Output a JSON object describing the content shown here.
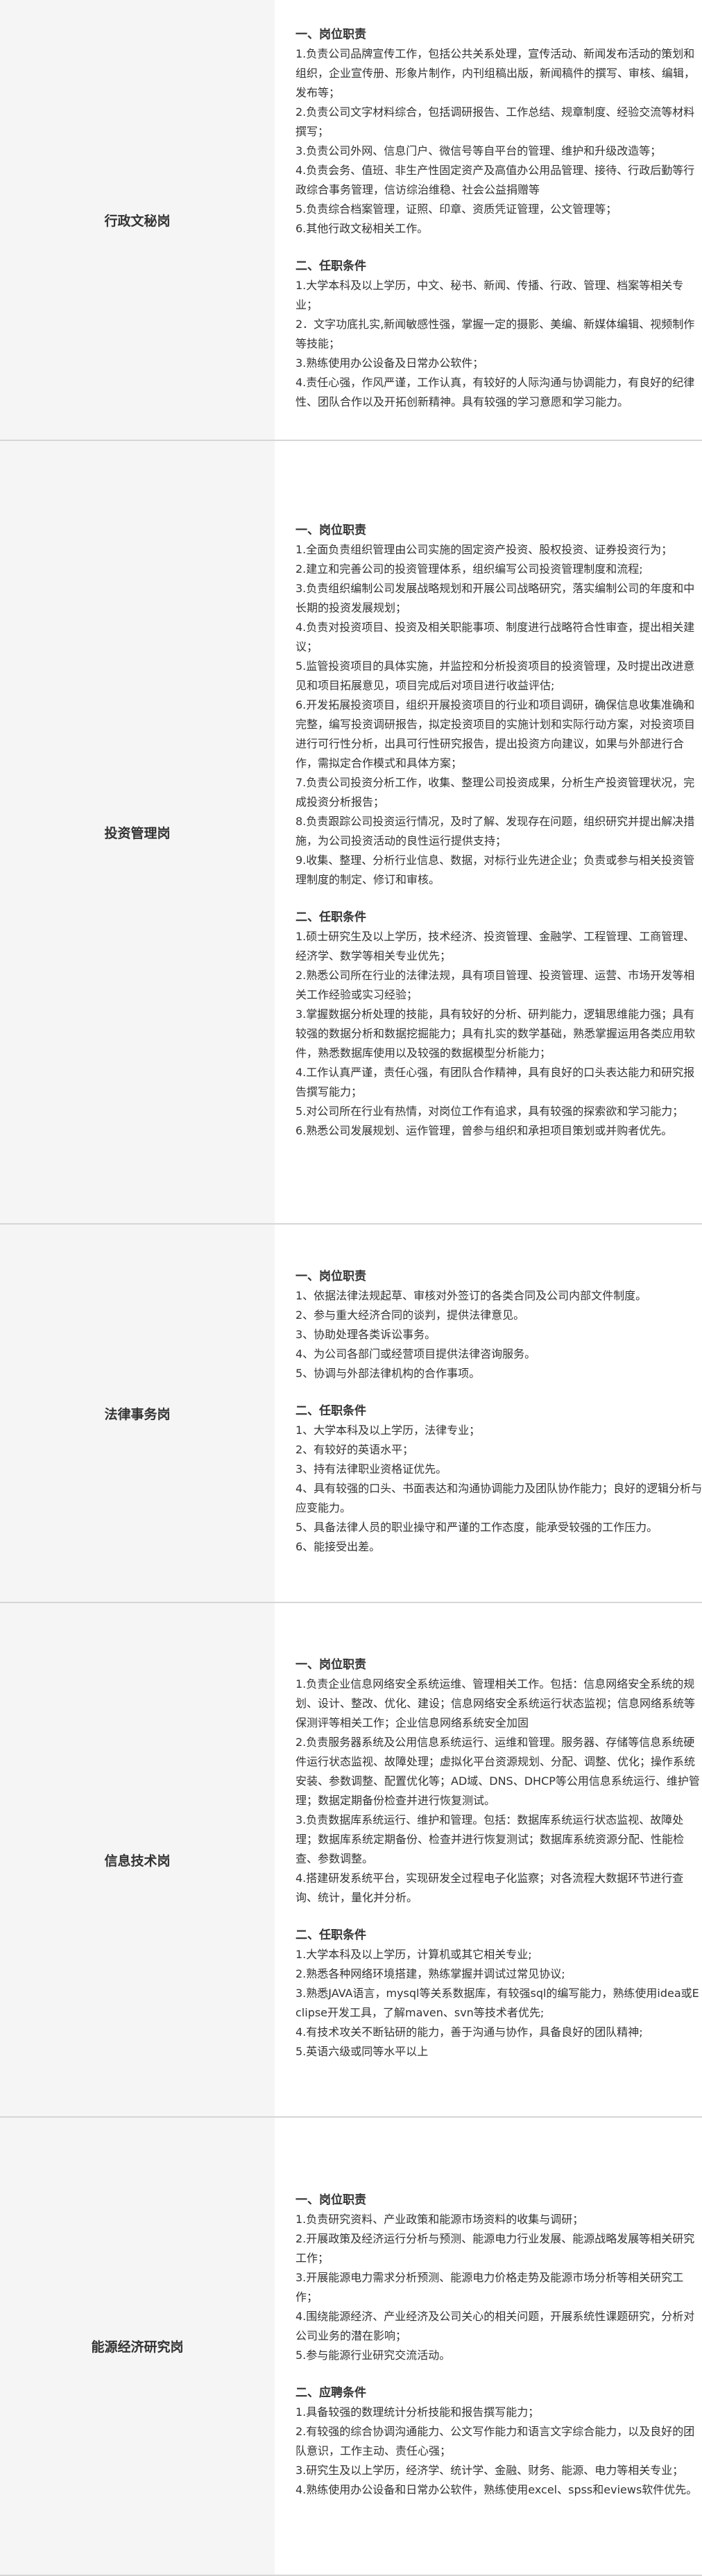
{
  "jobs": [
    {
      "title": "行政文秘岗",
      "sections": [
        {
          "heading": "一、岗位职责",
          "lines": [
            "1.负责公司品牌宣传工作，包括公共关系处理，宣传活动、新闻发布活动的策划和组织，企业宣传册、形象片制作，内刊组稿出版，新闻稿件的撰写、审核、编辑，发布等；",
            "2.负责公司文字材料综合，包括调研报告、工作总结、规章制度、经验交流等材料撰写；",
            "3.负责公司外网、信息门户、微信号等自平台的管理、维护和升级改造等；",
            "4.负责会务、值班、非生产性固定资产及高值办公用品管理、接待、行政后勤等行政综合事务管理，信访综治维稳、社会公益捐赠等",
            "5.负责综合档案管理，证照、印章、资质凭证管理，公文管理等；",
            "6.其他行政文秘相关工作。"
          ]
        },
        {
          "heading": "二、任职条件",
          "lines": [
            "1.大学本科及以上学历，中文、秘书、新闻、传播、行政、管理、档案等相关专业；",
            "2．文字功底扎实,新闻敏感性强，掌握一定的摄影、美编、新媒体编辑、视频制作等技能；",
            "3.熟练使用办公设备及日常办公软件；",
            "4.责任心强，作风严谨，工作认真，有较好的人际沟通与协调能力，有良好的纪律性、团队合作以及开拓创新精神。具有较强的学习意愿和学习能力。"
          ]
        }
      ]
    },
    {
      "title": "投资管理岗",
      "sections": [
        {
          "heading": "一、岗位职责",
          "lines": [
            "1.全面负责组织管理由公司实施的固定资产投资、股权投资、证券投资行为；",
            "2.建立和完善公司的投资管理体系，组织编写公司投资管理制度和流程;",
            "3.负责组织编制公司发展战略规划和开展公司战略研究，落实编制公司的年度和中长期的投资发展规划；",
            "4.负责对投资项目、投资及相关职能事项、制度进行战略符合性审查，提出相关建议；",
            "5.监管投资项目的具体实施，并监控和分析投资项目的投资管理，及时提出改进意见和项目拓展意见，项目完成后对项目进行收益评估;",
            "6.开发拓展投资项目，组织开展投资项目的行业和项目调研，确保信息收集准确和完整，编写投资调研报告，拟定投资项目的实施计划和实际行动方案，对投资项目进行可行性分析，出具可行性研究报告，提出投资方向建议，如果与外部进行合作，需拟定合作模式和具体方案；",
            "7.负责公司投资分析工作，收集、整理公司投资成果，分析生产投资管理状况，完成投资分析报告；",
            "8.负责跟踪公司投资运行情况，及时了解、发现存在问题，组织研究并提出解决措施，为公司投资活动的良性运行提供支持；",
            "9.收集、整理、分析行业信息、数据，对标行业先进企业；负责或参与相关投资管理制度的制定、修订和审核。"
          ]
        },
        {
          "heading": "二、任职条件",
          "lines": [
            "1.硕士研究生及以上学历，技术经济、投资管理、金融学、工程管理、工商管理、经济学、数学等相关专业优先；",
            "2.熟悉公司所在行业的法律法规，具有项目管理、投资管理、运营、市场开发等相关工作经验或实习经验；",
            "3.掌握数据分析处理的技能，具有较好的分析、研判能力，逻辑思维能力强；具有较强的数据分析和数据挖掘能力；具有扎实的数学基础，熟悉掌握运用各类应用软件，熟悉数据库使用以及较强的数据模型分析能力；",
            "4.工作认真严谨，责任心强，有团队合作精神，具有良好的口头表达能力和研究报告撰写能力；",
            "5.对公司所在行业有热情，对岗位工作有追求，具有较强的探索欲和学习能力；",
            "6.熟悉公司发展规划、运作管理，曾参与组织和承担项目策划或并购者优先。"
          ]
        }
      ]
    },
    {
      "title": "法律事务岗",
      "sections": [
        {
          "heading": "一、岗位职责",
          "lines": [
            "1、依据法律法规起草、审核对外签订的各类合同及公司内部文件制度。",
            "2、参与重大经济合同的谈判，提供法律意见。",
            "3、协助处理各类诉讼事务。",
            "4、为公司各部门或经营项目提供法律咨询服务。",
            "5、协调与外部法律机构的合作事项。"
          ]
        },
        {
          "heading": "二、任职条件",
          "lines": [
            "1、大学本科及以上学历，法律专业；",
            "2、有较好的英语水平；",
            "3、持有法律职业资格证优先。",
            "4、具有较强的口头、书面表达和沟通协调能力及团队协作能力；良好的逻辑分析与应变能力。",
            "5、具备法律人员的职业操守和严谨的工作态度，能承受较强的工作压力。",
            "6、能接受出差。"
          ]
        }
      ]
    },
    {
      "title": "信息技术岗",
      "sections": [
        {
          "heading": "一、岗位职责",
          "lines": [
            "1.负责企业信息网络安全系统运维、管理相关工作。包括：信息网络安全系统的规划、设计、整改、优化、建设；信息网络安全系统运行状态监视；信息网络系统等保测评等相关工作；企业信息网络系统安全加固",
            "2.负责服务器系统及公用信息系统运行、运维和管理。服务器、存储等信息系统硬件运行状态监视、故障处理；虚拟化平台资源规划、分配、调整、优化；操作系统安装、参数调整、配置优化等；AD域、DNS、DHCP等公用信息系统运行、维护管理；数据定期备份检查并进行恢复测试。",
            "3.负责数据库系统运行、维护和管理。包括：数据库系统运行状态监视、故障处理；数据库系统定期备份、检查并进行恢复测试；数据库系统资源分配、性能检查、参数调整。",
            "4.搭建研发系统平台，实现研发全过程电子化监察；对各流程大数据环节进行查询、统计，量化并分析。"
          ]
        },
        {
          "heading": "二、任职条件",
          "lines": [
            "1.大学本科及以上学历，计算机或其它相关专业;",
            "2.熟悉各种网络环境搭建，熟练掌握并调试过常见协议;",
            "3.熟悉JAVA语言，mysql等关系数据库，有较强sql的编写能力，熟练使用idea或Eclipse开发工具，了解maven、svn等技术者优先;",
            "4.有技术攻关不断钻研的能力，善于沟通与协作，具备良好的团队精神;",
            "5.英语六级或同等水平以上"
          ]
        }
      ]
    },
    {
      "title": "能源经济研究岗",
      "sections": [
        {
          "heading": "一、岗位职责",
          "lines": [
            "1.负责研究资料、产业政策和能源市场资料的收集与调研；",
            "2.开展政策及经济运行分析与预测、能源电力行业发展、能源战略发展等相关研究工作；",
            "3.开展能源电力需求分析预测、能源电力价格走势及能源市场分析等相关研究工作；",
            "4.围绕能源经济、产业经济及公司关心的相关问题，开展系统性课题研究，分析对公司业务的潜在影响；",
            "5.参与能源行业研究交流活动。"
          ]
        },
        {
          "heading": "二、应聘条件",
          "lines": [
            "1.具备较强的数理统计分析技能和报告撰写能力；",
            "2.有较强的综合协调沟通能力、公文写作能力和语言文字综合能力，以及良好的团队意识，工作主动、责任心强；",
            "3.研究生及以上学历，经济学、统计学、金融、财务、能源、电力等相关专业；",
            "4.熟练使用办公设备和日常办公软件，熟练使用excel、spss和eviews软件优先。"
          ]
        }
      ]
    }
  ]
}
